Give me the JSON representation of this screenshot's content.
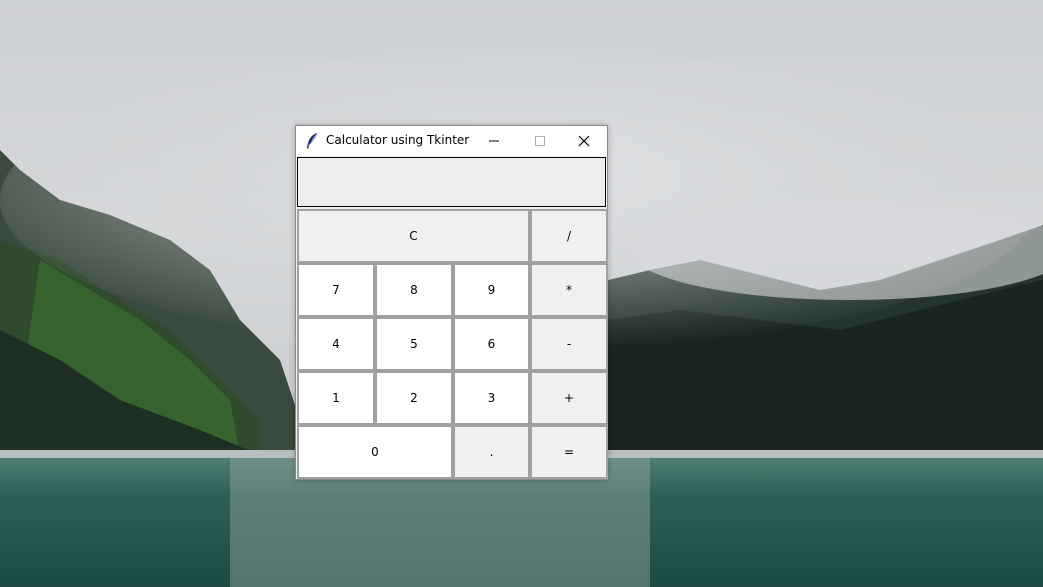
{
  "window": {
    "title": "Calculator using Tkinter",
    "icon": "feather-icon",
    "controls": {
      "minimize_icon": "minimize-icon",
      "maximize_icon": "maximize-icon",
      "close_icon": "close-icon"
    }
  },
  "display": {
    "value": ""
  },
  "keys": {
    "clear": "C",
    "divide": "/",
    "seven": "7",
    "eight": "8",
    "nine": "9",
    "multiply": "*",
    "four": "4",
    "five": "5",
    "six": "6",
    "subtract": "-",
    "one": "1",
    "two": "2",
    "three": "3",
    "add": "+",
    "zero": "0",
    "decimal": ".",
    "equals": "="
  },
  "colors": {
    "titlebar": "#ffffff",
    "window_bg": "#f0f0f0",
    "key_bg": "#ffffff",
    "operator_key_bg": "#f0f0f0",
    "key_border": "#a0a0a0"
  }
}
